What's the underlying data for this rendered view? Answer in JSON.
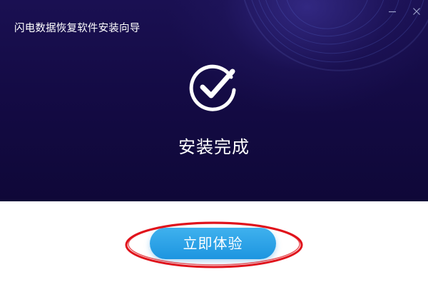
{
  "window": {
    "title": "闪电数据恢复软件安装向导"
  },
  "controls": {
    "minimize_icon": "minimize-icon",
    "close_icon": "close-icon"
  },
  "status": {
    "icon": "check-circle-icon",
    "text": "安装完成"
  },
  "actions": {
    "primary_label": "立即体验"
  },
  "colors": {
    "hero_background": "#140b45",
    "primary_button": "#2aa3e8",
    "annotation_ring": "#e0121b"
  }
}
